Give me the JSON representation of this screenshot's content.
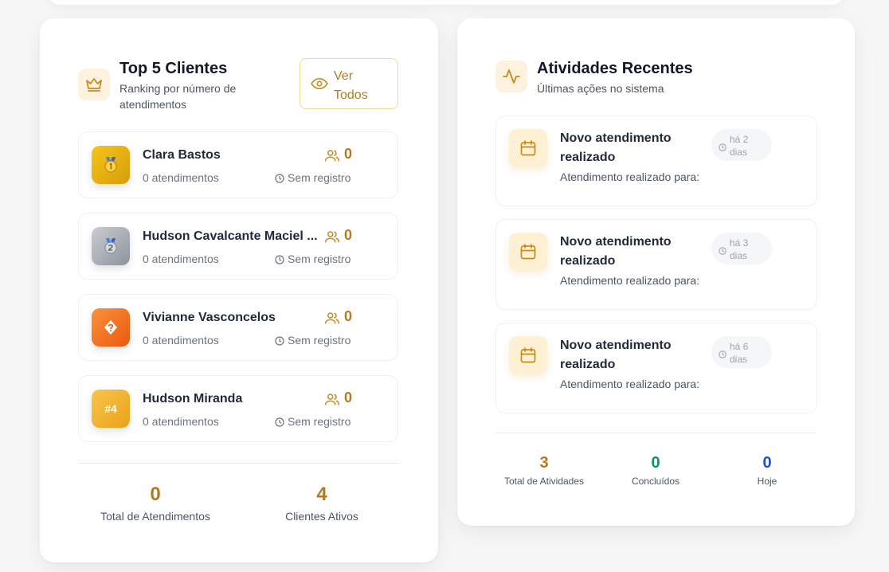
{
  "top_clients": {
    "title": "Top 5 Clientes",
    "subtitle": "Ranking por número de atendimentos",
    "view_all_label": "Ver Todos",
    "clients": [
      {
        "name": "Clara Bastos",
        "meta": "0 atendimentos",
        "count": "0",
        "last": "Sem registro",
        "badge": "medal-gold"
      },
      {
        "name": "Hudson Cavalcante Maciel ...",
        "meta": "0 atendimentos",
        "count": "0",
        "last": "Sem registro",
        "badge": "medal-silver"
      },
      {
        "name": "Vivianne Vasconcelos",
        "meta": "0 atendimentos",
        "count": "0",
        "last": "Sem registro",
        "badge": "?"
      },
      {
        "name": "Hudson Miranda",
        "meta": "0 atendimentos",
        "count": "0",
        "last": "Sem registro",
        "badge": "#4"
      }
    ],
    "stats": {
      "total_value": "0",
      "total_label": "Total de Atendimentos",
      "active_value": "4",
      "active_label": "Clientes Ativos"
    }
  },
  "recent_activities": {
    "title": "Atividades Recentes",
    "subtitle": "Últimas ações no sistema",
    "items": [
      {
        "title": "Novo atendimento realizado",
        "description": "Atendimento realizado para:",
        "time": "há 2 dias"
      },
      {
        "title": "Novo atendimento realizado",
        "description": "Atendimento realizado para:",
        "time": "há 3 dias"
      },
      {
        "title": "Novo atendimento realizado",
        "description": "Atendimento realizado para:",
        "time": "há 6 dias"
      }
    ],
    "stats": [
      {
        "value": "3",
        "label": "Total de Atividades",
        "color": "#b7791f"
      },
      {
        "value": "0",
        "label": "Concluídos",
        "color": "#059669"
      },
      {
        "value": "0",
        "label": "Hoje",
        "color": "#1d4ed8"
      }
    ]
  },
  "colors": {
    "accent": "#b7791f",
    "success": "#059669",
    "info": "#1d4ed8"
  }
}
